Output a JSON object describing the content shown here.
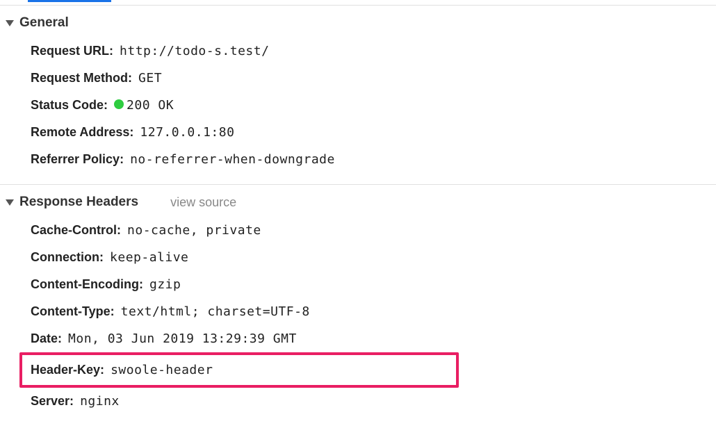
{
  "sections": {
    "general": {
      "title": "General",
      "request_url_label": "Request URL:",
      "request_url_value": "http://todo-s.test/",
      "request_method_label": "Request Method:",
      "request_method_value": "GET",
      "status_code_label": "Status Code:",
      "status_code_value": "200 OK",
      "remote_address_label": "Remote Address:",
      "remote_address_value": "127.0.0.1:80",
      "referrer_policy_label": "Referrer Policy:",
      "referrer_policy_value": "no-referrer-when-downgrade"
    },
    "response_headers": {
      "title": "Response Headers",
      "view_source_label": "view source",
      "cache_control_label": "Cache-Control:",
      "cache_control_value": "no-cache, private",
      "connection_label": "Connection:",
      "connection_value": "keep-alive",
      "content_encoding_label": "Content-Encoding:",
      "content_encoding_value": "gzip",
      "content_type_label": "Content-Type:",
      "content_type_value": "text/html; charset=UTF-8",
      "date_label": "Date:",
      "date_value": "Mon, 03 Jun 2019 13:29:39 GMT",
      "header_key_label": "Header-Key:",
      "header_key_value": "swoole-header",
      "server_label": "Server:",
      "server_value": "nginx"
    }
  }
}
